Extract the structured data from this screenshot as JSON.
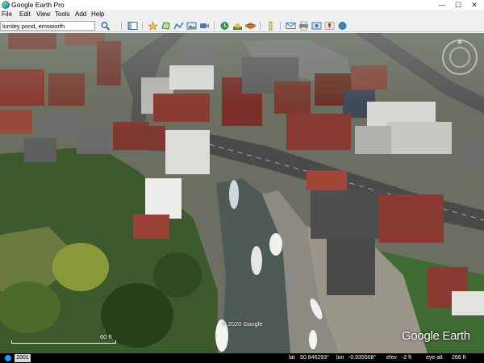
{
  "window": {
    "title": "Google Earth Pro",
    "minimize": "—",
    "maximize": "☐",
    "close": "✕"
  },
  "menu": [
    {
      "label": "File",
      "accel": "F"
    },
    {
      "label": "Edit",
      "accel": "E"
    },
    {
      "label": "View",
      "accel": "V"
    },
    {
      "label": "Tools",
      "accel": "T"
    },
    {
      "label": "Add",
      "accel": "A"
    },
    {
      "label": "Help",
      "accel": "H"
    }
  ],
  "search": {
    "value": "lumley pond, emsworth",
    "button_icon": "search-icon"
  },
  "toolbar": {
    "buttons": [
      {
        "name": "sidebar-toggle-icon"
      },
      {
        "name": "add-placemark-icon"
      },
      {
        "name": "add-polygon-icon"
      },
      {
        "name": "add-path-icon"
      },
      {
        "name": "add-image-overlay-icon"
      },
      {
        "name": "record-tour-icon"
      },
      {
        "name": "historical-imagery-icon"
      },
      {
        "name": "sunlight-icon"
      },
      {
        "name": "planets-icon"
      },
      {
        "name": "ruler-icon"
      },
      {
        "name": "email-icon"
      },
      {
        "name": "print-icon"
      },
      {
        "name": "save-image-icon"
      },
      {
        "name": "google-maps-icon"
      },
      {
        "name": "earth-gallery-icon"
      }
    ]
  },
  "map": {
    "copyright": "© 2020 Google",
    "logo": "Google Earth",
    "scale_label": "60 ft",
    "compass_icon": "navigation-compass-icon"
  },
  "status": {
    "year": "2001",
    "lat_label": "lat",
    "lat_value": "50.846293°",
    "lon_label": "lon",
    "lon_value": "-0.935508°",
    "elev_label": "elev",
    "elev_value": "-2 ft",
    "eye_label": "eye alt",
    "eye_value": "266 ft"
  },
  "colors": {
    "road": "#4a4a4a",
    "water": "#4e5a56",
    "grass": "#3e6b2e",
    "roof_red": "#8a3a30",
    "roof_grey": "#6d6d6d"
  }
}
